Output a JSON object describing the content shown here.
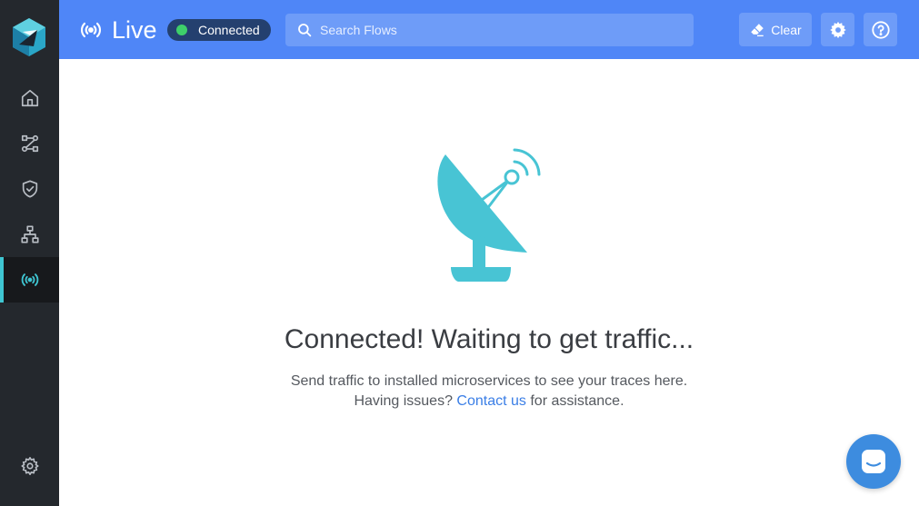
{
  "header": {
    "title": "Live",
    "status": "Connected",
    "search_placeholder": "Search Flows",
    "clear_label": "Clear"
  },
  "main": {
    "headline": "Connected! Waiting to get traffic...",
    "line1": "Send traffic to installed microservices to see your traces here.",
    "line2_prefix": "Having issues?",
    "contact_link": "Contact us",
    "line2_suffix": "for assistance."
  },
  "sidebar": {
    "items": [
      {
        "icon": "home-icon"
      },
      {
        "icon": "flows-icon"
      },
      {
        "icon": "shield-check-icon"
      },
      {
        "icon": "topology-icon"
      },
      {
        "icon": "broadcast-icon",
        "active": true
      }
    ],
    "bottom_icon": "gear-icon"
  },
  "colors": {
    "sidebar_bg": "#24282d",
    "header_bg": "#4f86f7",
    "accent": "#3fc6d2",
    "status_dot": "#3ecf6a",
    "link": "#3a7ee6",
    "chat_bg": "#3d8cdf"
  }
}
